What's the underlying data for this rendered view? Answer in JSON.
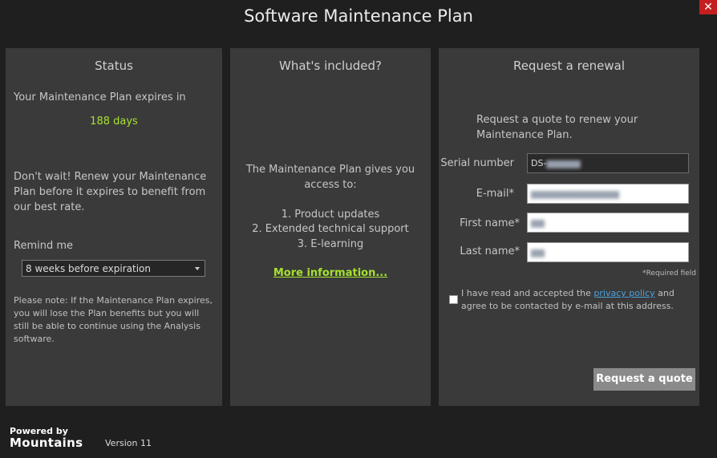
{
  "window": {
    "title": "Software Maintenance Plan",
    "close_glyph": "✕"
  },
  "status": {
    "heading": "Status",
    "expires_label": "Your Maintenance Plan expires in",
    "days_left": "188 days",
    "renew_text": "Don't wait! Renew your Maintenance Plan before it expires to benefit from our best rate.",
    "remind_label": "Remind me",
    "remind_selected": "8 weeks before expiration",
    "note": "Please note: If the Maintenance Plan expires, you will lose the Plan benefits but you will still be able to continue using the Analysis software."
  },
  "included": {
    "heading": "What's included?",
    "intro_line1": "The Maintenance Plan gives you",
    "intro_line2": "access to:",
    "items": [
      "1. Product updates",
      "2. Extended technical support",
      "3. E-learning"
    ],
    "more_link": "More information..."
  },
  "renewal": {
    "heading": "Request a renewal",
    "intro": "Request a quote to renew your Maintenance Plan.",
    "serial_label": "Serial number",
    "serial_value": "DS-",
    "email_label": "E-mail*",
    "first_label": "First name*",
    "last_label": "Last name*",
    "required_note": "*Required field",
    "consent_before": "I have read and accepted the ",
    "consent_link": "privacy policy",
    "consent_after": " and agree to be contacted by e-mail at this address.",
    "button_label": "Request a quote"
  },
  "footer": {
    "powered_by": "Powered by",
    "brand": "Mountains",
    "version": "Version 11"
  },
  "colors": {
    "accent_green": "#a6e22e",
    "link_blue": "#4aa3df",
    "close_red": "#c41e1e"
  }
}
